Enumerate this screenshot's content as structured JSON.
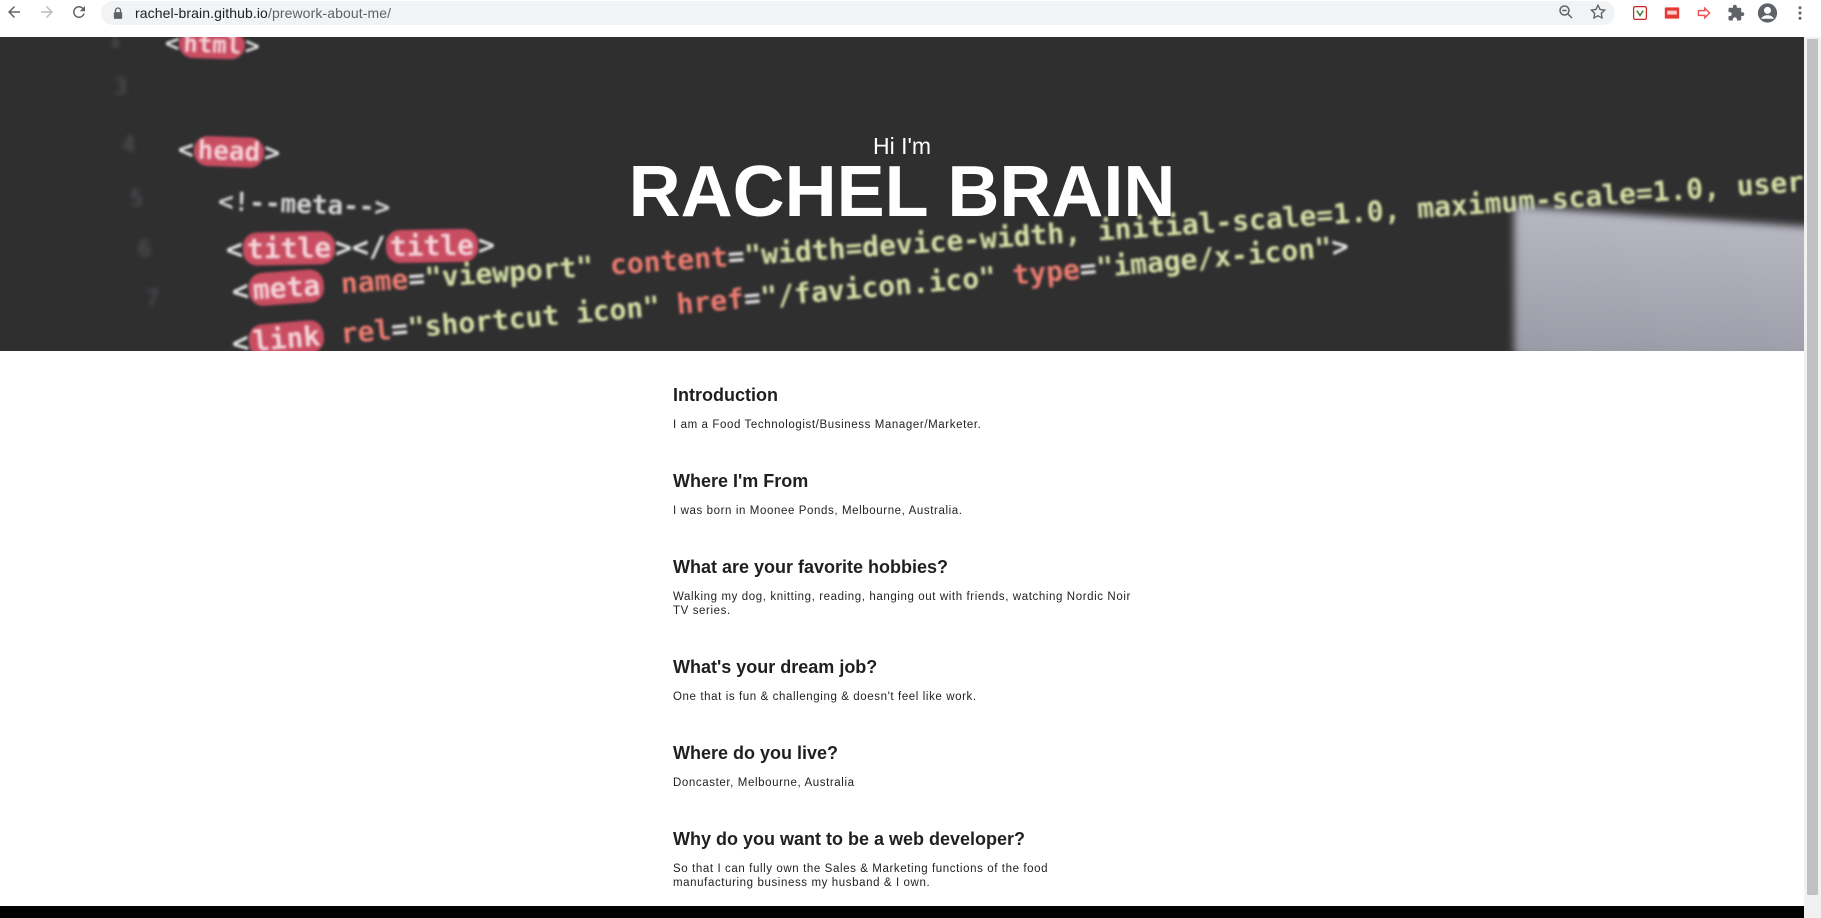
{
  "browser": {
    "url_host": "rachel-brain.github.io",
    "url_path": "/prework-about-me/"
  },
  "hero": {
    "greeting": "Hi I'm",
    "name": "RACHEL BRAIN"
  },
  "sections": [
    {
      "heading": "Introduction",
      "text": "I am a Food Technologist/Business Manager/Marketer."
    },
    {
      "heading": "Where I'm From",
      "text": "I was born in Moonee Ponds, Melbourne, Australia."
    },
    {
      "heading": "What are your favorite hobbies?",
      "text": "Walking my dog, knitting, reading, hanging out with friends, watching Nordic Noir TV series."
    },
    {
      "heading": "What's your dream job?",
      "text": "One that is fun & challenging & doesn't feel like work."
    },
    {
      "heading": "Where do you live?",
      "text": "Doncaster, Melbourne, Australia"
    },
    {
      "heading": "Why do you want to be a web developer?",
      "text": "So that I can fully own the Sales & Marketing functions of the food manufacturing business my husband & I own."
    }
  ],
  "colors": {
    "hero_bg": "#2f2f30",
    "footer": "#000000",
    "text": "#222222"
  }
}
